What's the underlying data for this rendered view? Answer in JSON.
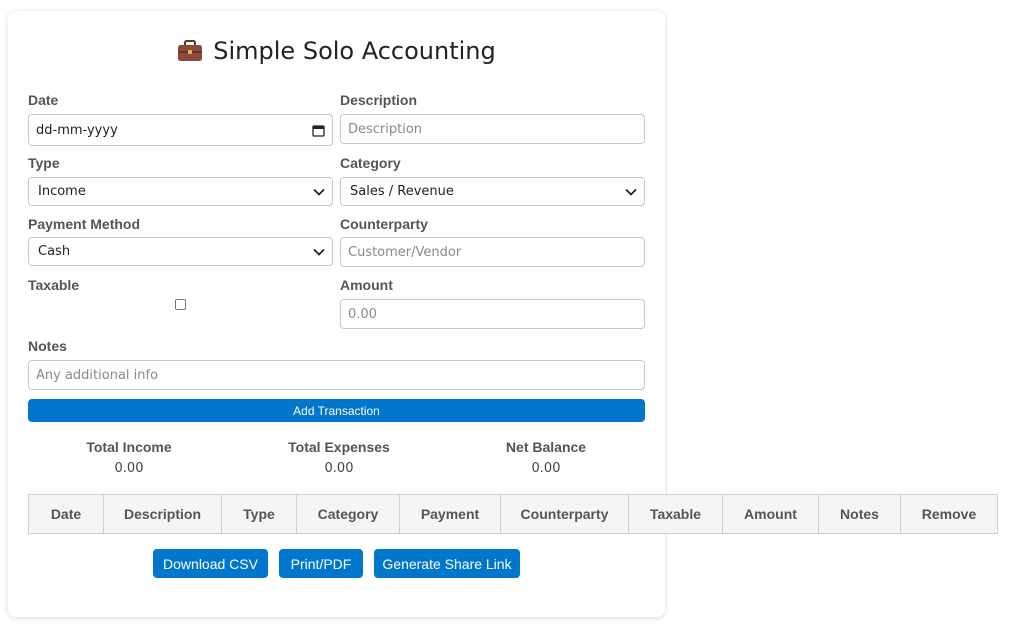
{
  "app": {
    "title": "Simple Solo Accounting"
  },
  "form": {
    "date": {
      "label": "Date",
      "value": "dd-mm-yyyy"
    },
    "description": {
      "label": "Description",
      "placeholder": "Description"
    },
    "type": {
      "label": "Type",
      "value": "Income"
    },
    "category": {
      "label": "Category",
      "value": "Sales / Revenue"
    },
    "payment_method": {
      "label": "Payment Method",
      "value": "Cash"
    },
    "counterparty": {
      "label": "Counterparty",
      "placeholder": "Customer/Vendor"
    },
    "taxable": {
      "label": "Taxable",
      "checked": false
    },
    "amount": {
      "label": "Amount",
      "placeholder": "0.00"
    },
    "notes": {
      "label": "Notes",
      "placeholder": "Any additional info"
    },
    "submit_label": "Add Transaction"
  },
  "totals": {
    "income": {
      "label": "Total Income",
      "value": "0.00"
    },
    "expenses": {
      "label": "Total Expenses",
      "value": "0.00"
    },
    "net": {
      "label": "Net Balance",
      "value": "0.00"
    }
  },
  "table": {
    "columns": [
      "Date",
      "Description",
      "Type",
      "Category",
      "Payment",
      "Counterparty",
      "Taxable",
      "Amount",
      "Notes",
      "Remove"
    ]
  },
  "actions": {
    "download_csv": "Download CSV",
    "print_pdf": "Print/PDF",
    "share_link": "Generate Share Link"
  },
  "icons": {
    "title_icon": "briefcase-icon",
    "accent": "#0077cc"
  }
}
